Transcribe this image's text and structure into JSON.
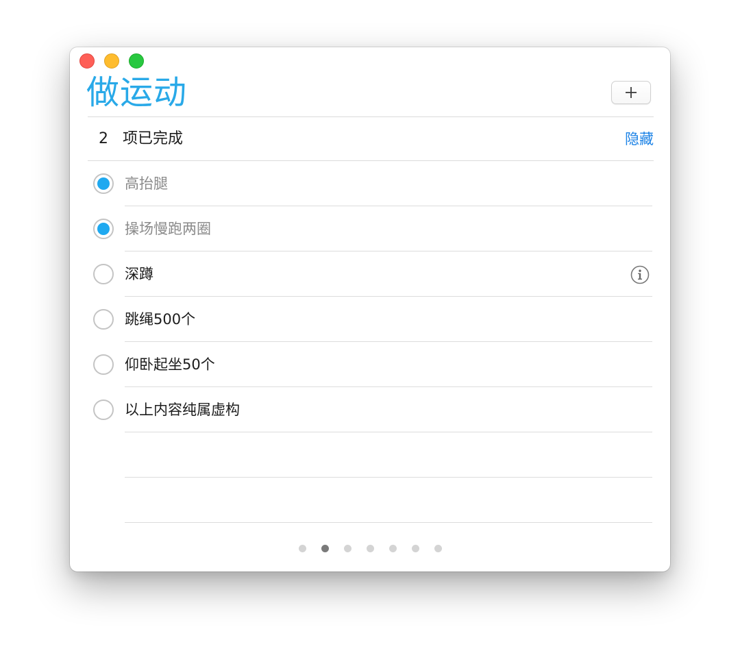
{
  "window": {
    "traffic_lights": [
      "close",
      "minimize",
      "zoom"
    ]
  },
  "list": {
    "title": "做运动",
    "add_icon": "plus-icon",
    "accent_color": "#29a9e8"
  },
  "completed": {
    "count": "2",
    "label": "项已完成",
    "hide_label": "隐藏"
  },
  "tasks": [
    {
      "text": "高抬腿",
      "done": true
    },
    {
      "text": "操场慢跑两圈",
      "done": true
    },
    {
      "text": "深蹲",
      "done": false,
      "info_icon": "info-icon"
    },
    {
      "text": "跳绳500个",
      "done": false
    },
    {
      "text": "仰卧起坐50个",
      "done": false
    },
    {
      "text": "以上内容纯属虚构",
      "done": false
    }
  ],
  "pager": {
    "total_pages": 7,
    "active_page": 2
  }
}
